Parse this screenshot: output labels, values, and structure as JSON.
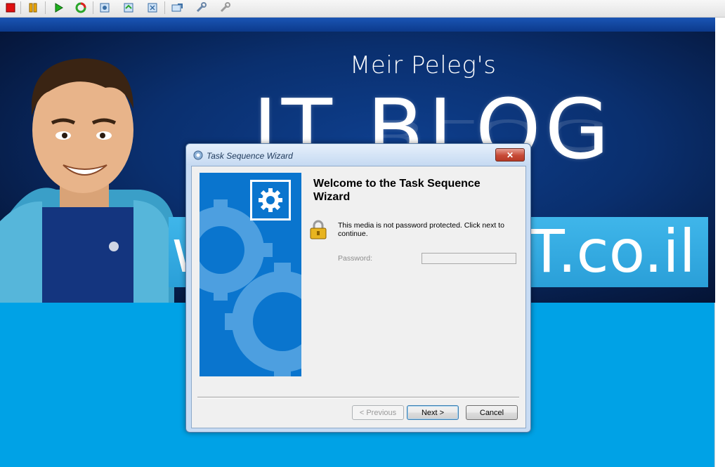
{
  "banner": {
    "byline": "Meir Peleg's",
    "title": "IT BLOG",
    "domain_left": "w",
    "domain_right": "IT.co.il"
  },
  "dialog": {
    "title": "Task Sequence Wizard",
    "close_glyph": "✕",
    "heading": "Welcome to the Task Sequence Wizard",
    "message": "This media is not password protected.  Click next to continue.",
    "password_label": "Password:",
    "password_value": "",
    "buttons": {
      "previous": "< Previous",
      "next": "Next >",
      "cancel": "Cancel"
    }
  },
  "colors": {
    "desktop": "#00a2e6",
    "wizard_panel": "#0a75ce",
    "gear_light": "#4d9fe0"
  }
}
